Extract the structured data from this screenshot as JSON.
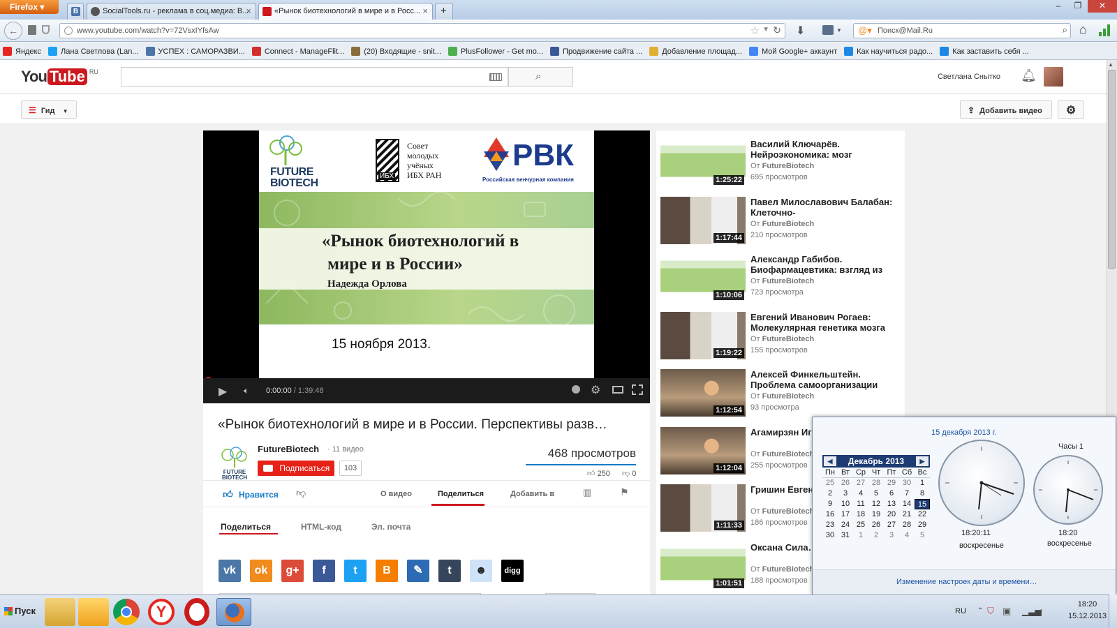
{
  "browser": {
    "menu_button": "Firefox",
    "tabs": [
      {
        "label": "В",
        "icon_color": "#4a76a8"
      },
      {
        "label": "SocialTools.ru - реклама в соц.медиа: В...",
        "icon_color": "#555555"
      },
      {
        "label": "«Рынок биотехнологий в мире и в Росс...",
        "icon_color": "#cc181e"
      }
    ],
    "new_tab": "+",
    "url": "www.youtube.com/watch?v=72VsxIYfsAw",
    "search_placeholder": "Поиск@Mail.Ru",
    "bookmarks": [
      {
        "label": "Яндекс",
        "icon_color": "#e52620"
      },
      {
        "label": "Лана Светлова (Lan...",
        "icon_color": "#1da1f2"
      },
      {
        "label": "УСПЕХ : САМОРАЗВИ...",
        "icon_color": "#4a76a8"
      },
      {
        "label": "Connect - ManageFlit...",
        "icon_color": "#d32f2f"
      },
      {
        "label": "(20) Входящие - snit...",
        "icon_color": "#8a6d3b"
      },
      {
        "label": "PlusFollower - Get mo...",
        "icon_color": "#4caf50"
      },
      {
        "label": "Продвижение сайта ...",
        "icon_color": "#3b5998"
      },
      {
        "label": "Добавление площад...",
        "icon_color": "#e0b030"
      },
      {
        "label": "Мой Google+ аккаунт",
        "icon_color": "#4285f4"
      },
      {
        "label": "Как научиться радо...",
        "icon_color": "#1e88e5"
      },
      {
        "label": "Как заставить себя ...",
        "icon_color": "#1e88e5"
      }
    ]
  },
  "youtube": {
    "logo_you": "You",
    "logo_tube": "Tube",
    "logo_region": "RU",
    "user_name": "Светлана Снытко",
    "guide_label": "Гид",
    "upload_label": "Добавить видео"
  },
  "player": {
    "time_current": "0:00:00",
    "time_total": "1:39:48",
    "slide": {
      "logo_left_line1": "FUTURE",
      "logo_left_line2": "BIOTECH",
      "council_mark": "ИБХ",
      "council_lines": [
        "Совет",
        "молодых",
        "учёных",
        "ИБХ РАН"
      ],
      "rvk": "РВК",
      "rvk_sub": "Российская венчурная компания",
      "title_line1": "«Рынок биотехнологий в",
      "title_line2": "мире и в России»",
      "speaker": "Надежда Орлова",
      "date": "15 ноября 2013."
    }
  },
  "video": {
    "title": "«Рынок биотехнологий в мире и в России. Перспективы разв…",
    "channel": "FutureBiotech",
    "channel_videos": "11 видео",
    "channel_logo_line1": "FUTURE",
    "channel_logo_line2": "BIOTECH",
    "subscribe_label": "Подписаться",
    "subscriber_count": "103",
    "views": "468 просмотров",
    "likes": "250",
    "dislikes": "0",
    "like_label": "Нравится",
    "action_tabs": [
      "О видео",
      "Поделиться",
      "Добавить в"
    ],
    "share_tabs": [
      "Поделиться",
      "HTML-код",
      "Эл. почта"
    ],
    "share_services": [
      {
        "name": "vk",
        "glyph": "vk",
        "color": "#4a76a8"
      },
      {
        "name": "odnoklassniki",
        "glyph": "ok",
        "color": "#f08b1d"
      },
      {
        "name": "google-plus",
        "glyph": "g+",
        "color": "#dd4b39"
      },
      {
        "name": "facebook",
        "glyph": "f",
        "color": "#3b5998"
      },
      {
        "name": "twitter",
        "glyph": "t",
        "color": "#1da1f2"
      },
      {
        "name": "blogger",
        "glyph": "B",
        "color": "#f57d00"
      },
      {
        "name": "livejournal",
        "glyph": "✎",
        "color": "#2d6bb4"
      },
      {
        "name": "tumblr",
        "glyph": "t",
        "color": "#35465c"
      },
      {
        "name": "reddit",
        "glyph": "☻",
        "color": "#cee3f8"
      },
      {
        "name": "digg",
        "glyph": "digg",
        "color": "#000000"
      }
    ]
  },
  "related": [
    {
      "title": "Василий Ключарёв. Нейроэкономика: мозг",
      "by_prefix": "От",
      "channel": "FutureBiotech",
      "views": "695 просмотров",
      "duration": "1:25:22",
      "thumb": "slide"
    },
    {
      "title": "Павел Милославович Балабан: Клеточно-",
      "by_prefix": "От",
      "channel": "FutureBiotech",
      "views": "210 просмотров",
      "duration": "1:17:44",
      "thumb": "person"
    },
    {
      "title": "Александр Габибов. Биофармацевтика: взгляд из",
      "by_prefix": "От",
      "channel": "FutureBiotech",
      "views": "723 просмотра",
      "duration": "1:10:06",
      "thumb": "slide"
    },
    {
      "title": "Евгений Иванович Рогаев: Молекулярная генетика мозга",
      "by_prefix": "От",
      "channel": "FutureBiotech",
      "views": "155 просмотров",
      "duration": "1:19:22",
      "thumb": "person"
    },
    {
      "title": "Алексей Финкельштейн. Проблема самоорганизации",
      "by_prefix": "От",
      "channel": "FutureBiotech",
      "views": "93 просмотра",
      "duration": "1:12:54",
      "thumb": "room"
    },
    {
      "title": "Агамирзян Иг… Глобальная э…",
      "by_prefix": "От",
      "channel": "FutureBiotech",
      "views": "255 просмотров",
      "duration": "1:12:04",
      "thumb": "room"
    },
    {
      "title": "Гришин Евген… Токсиномика…",
      "by_prefix": "От",
      "channel": "FutureBiotech",
      "views": "186 просмотров",
      "duration": "1:11:33",
      "thumb": "person"
    },
    {
      "title": "Оксана Сила… Мастерство п…",
      "by_prefix": "От",
      "channel": "FutureBiotech",
      "views": "188 просмотров",
      "duration": "1:01:51",
      "thumb": "slide"
    }
  ],
  "calendar": {
    "date_long": "15 декабря 2013 г.",
    "month_label": "Декабрь 2013",
    "weekdays": [
      "Пн",
      "Вт",
      "Ср",
      "Чт",
      "Пт",
      "Сб",
      "Вс"
    ],
    "weeks": [
      [
        "25",
        "26",
        "27",
        "28",
        "29",
        "30",
        "1"
      ],
      [
        "2",
        "3",
        "4",
        "5",
        "6",
        "7",
        "8"
      ],
      [
        "9",
        "10",
        "11",
        "12",
        "13",
        "14",
        "15"
      ],
      [
        "16",
        "17",
        "18",
        "19",
        "20",
        "21",
        "22"
      ],
      [
        "23",
        "24",
        "25",
        "26",
        "27",
        "28",
        "29"
      ],
      [
        "30",
        "31",
        "1",
        "2",
        "3",
        "4",
        "5"
      ]
    ],
    "selected_day": "15",
    "main_clock_time": "18:20:11",
    "main_clock_day": "воскресенье",
    "second_clock_name": "Часы 1",
    "second_clock_time": "18:20",
    "second_clock_day": "воскресенье",
    "settings_link": "Изменение настроек даты и времени…"
  },
  "taskbar": {
    "start_label": "Пуск",
    "language": "RU",
    "time": "18:20",
    "date": "15.12.2013"
  }
}
